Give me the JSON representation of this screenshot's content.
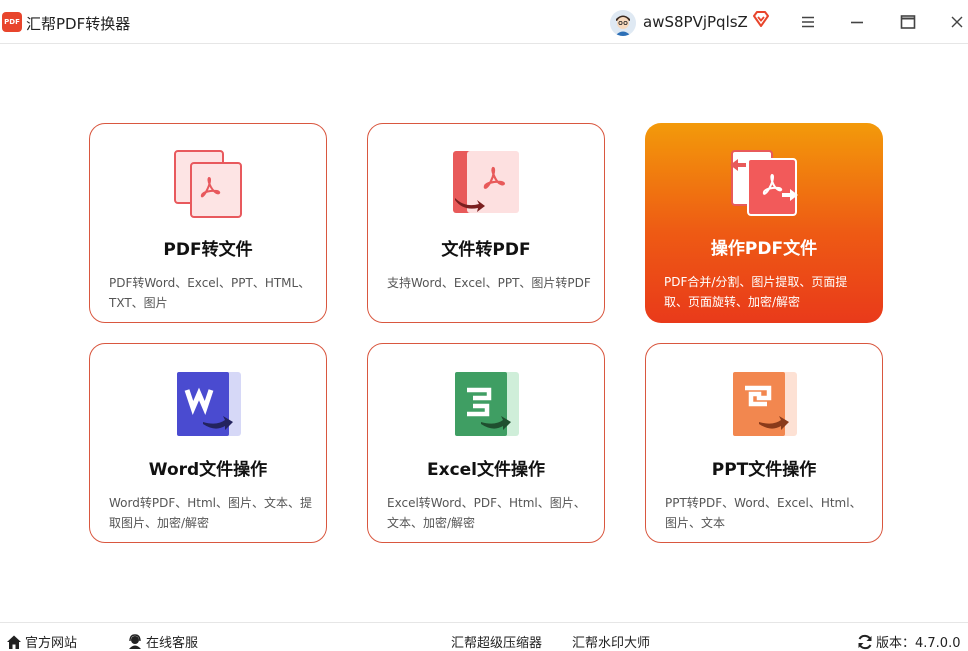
{
  "app": {
    "logo_text": "PDF",
    "title": "汇帮PDF转换器"
  },
  "user": {
    "name": "awS8PVjPqlsZ"
  },
  "cards": [
    {
      "title": "PDF转文件",
      "desc": "PDF转Word、Excel、PPT、HTML、TXT、图片",
      "icon": "pdf-to-file-icon",
      "color": "#e85a5a"
    },
    {
      "title": "文件转PDF",
      "desc": "支持Word、Excel、PPT、图片转PDF",
      "icon": "file-to-pdf-icon",
      "color": "#e85a5a"
    },
    {
      "title": "操作PDF文件",
      "desc": "PDF合并/分割、图片提取、页面提取、页面旋转、加密/解密",
      "icon": "pdf-operations-icon",
      "color": "#e85a5a"
    },
    {
      "title": "Word文件操作",
      "desc": "Word转PDF、Html、图片、文本、提取图片、加密/解密",
      "icon": "word-icon",
      "color": "#4a4bd0"
    },
    {
      "title": "Excel文件操作",
      "desc": "Excel转Word、PDF、Html、图片、文本、加密/解密",
      "icon": "excel-icon",
      "color": "#3f9e63"
    },
    {
      "title": "PPT文件操作",
      "desc": "PPT转PDF、Word、Excel、Html、图片、文本",
      "icon": "ppt-icon",
      "color": "#f2874f"
    }
  ],
  "footer": {
    "website": "官方网站",
    "support": "在线客服",
    "compressor": "汇帮超级压缩器",
    "watermark": "汇帮水印大师",
    "version": "版本：4.7.0.0"
  },
  "colors": {
    "accent": "#e8452c",
    "card_border": "#d9573f",
    "active_gradient_top": "#f39a0a",
    "active_gradient_bottom": "#e93a1a"
  }
}
